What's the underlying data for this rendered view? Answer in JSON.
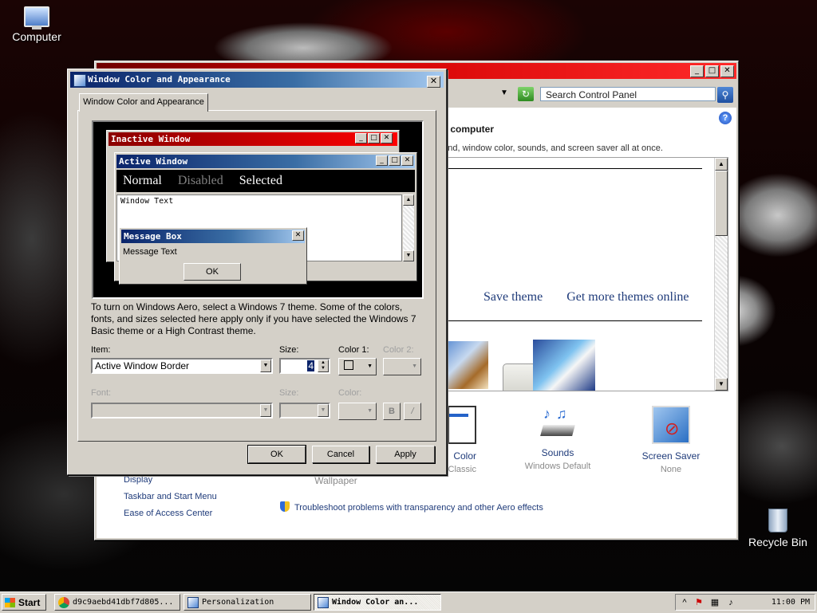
{
  "desktop": {
    "icons": [
      {
        "label": "Computer"
      },
      {
        "label": "Recycle Bin"
      }
    ]
  },
  "control_panel": {
    "search_placeholder": "Search Control Panel",
    "heading": "ur computer",
    "subheading": "ound, window color, sounds, and screen saver all at once.",
    "theme_links": [
      "Save theme",
      "Get more themes online"
    ],
    "items": [
      {
        "label": "Color",
        "sub": "Classic"
      },
      {
        "label": "Sounds",
        "sub": "Windows Default"
      },
      {
        "label": "Screen Saver",
        "sub": "None"
      }
    ],
    "wallpaper_sub": "Wallpaper",
    "see_also": [
      "Display",
      "Taskbar and Start Menu",
      "Ease of Access Center"
    ],
    "troubleshoot": "Troubleshoot problems with transparency and other Aero effects"
  },
  "dialog": {
    "title": "Window Color and Appearance",
    "tab": "Window Color and Appearance",
    "preview": {
      "inactive_title": "Inactive Window",
      "active_title": "Active Window",
      "menu": {
        "normal": "Normal",
        "disabled": "Disabled",
        "selected": "Selected"
      },
      "window_text": "Window Text",
      "msgbox_title": "Message Box",
      "msgbox_text": "Message Text",
      "msgbox_ok": "OK"
    },
    "info": "To turn on Windows Aero, select a Windows 7 theme.  Some of the colors, fonts, and sizes selected here apply only if you have selected the Windows 7 Basic theme or a High Contrast theme.",
    "item_label": "Item:",
    "item_value": "Active Window Border",
    "size_label": "Size:",
    "size_value": "4",
    "color1_label": "Color 1:",
    "color2_label": "Color 2:",
    "font_label": "Font:",
    "font_size_label": "Size:",
    "font_color_label": "Color:",
    "bold": "B",
    "italic": "/",
    "buttons": {
      "ok": "OK",
      "cancel": "Cancel",
      "apply": "Apply"
    }
  },
  "taskbar": {
    "start": "Start",
    "buttons": [
      {
        "label": "d9c9aebd41dbf7d805..."
      },
      {
        "label": "Personalization"
      },
      {
        "label": "Window Color an..."
      }
    ],
    "clock": "11:00 PM"
  },
  "colors": {
    "active_title_start": "#0a246a",
    "inactive_title_start": "#8b0000",
    "face": "#d4d0c8"
  }
}
